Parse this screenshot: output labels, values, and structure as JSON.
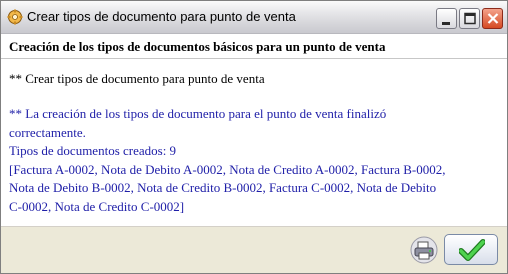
{
  "window": {
    "title": "Crear tipos de documento para punto de venta",
    "controls": {
      "minimize_icon": "minimize-icon",
      "maximize_icon": "maximize-icon",
      "close_icon": "close-icon"
    }
  },
  "content": {
    "heading": "Creación de los tipos de documentos básicos para un punto de venta",
    "status_line": "** Crear tipos de documento para punto de venta",
    "result_lines": [
      "** La creación de los tipos de documento para el punto de venta finalizó",
      "correctamente.",
      "Tipos de documentos creados: 9",
      "[Factura A-0002, Nota de Debito A-0002, Nota de Credito A-0002, Factura B-0002,",
      "Nota de Debito B-0002, Nota de Credito B-0002, Factura C-0002, Nota de Debito",
      "C-0002, Nota de Credito C-0002]"
    ]
  },
  "colors": {
    "result_text": "#1f1fa8",
    "window_bg": "#ece9d8",
    "content_bg": "#ffffff"
  },
  "footer": {
    "print_icon": "printer-icon",
    "ok_icon": "checkmark-icon"
  }
}
